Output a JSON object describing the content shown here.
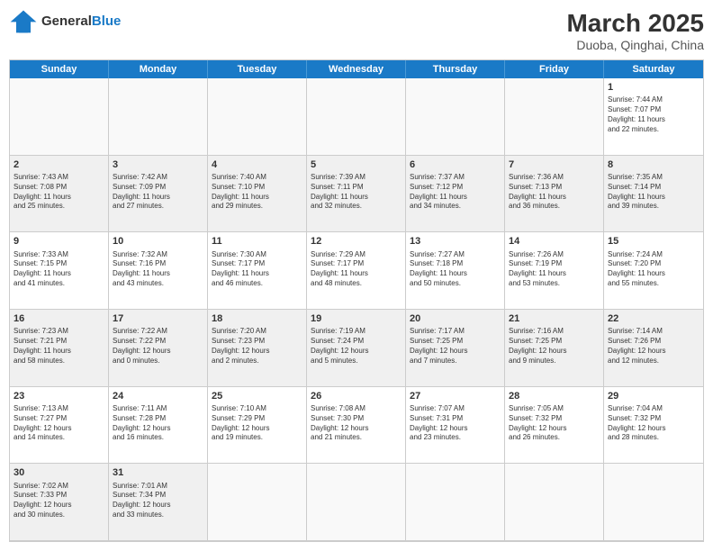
{
  "header": {
    "logo_general": "General",
    "logo_blue": "Blue",
    "month_title": "March 2025",
    "location": "Duoba, Qinghai, China"
  },
  "days_of_week": [
    "Sunday",
    "Monday",
    "Tuesday",
    "Wednesday",
    "Thursday",
    "Friday",
    "Saturday"
  ],
  "cells": [
    {
      "day": "",
      "text": "",
      "empty": true
    },
    {
      "day": "",
      "text": "",
      "empty": true
    },
    {
      "day": "",
      "text": "",
      "empty": true
    },
    {
      "day": "",
      "text": "",
      "empty": true
    },
    {
      "day": "",
      "text": "",
      "empty": true
    },
    {
      "day": "",
      "text": "",
      "empty": true
    },
    {
      "day": "1",
      "text": "Sunrise: 7:44 AM\nSunset: 7:07 PM\nDaylight: 11 hours\nand 22 minutes."
    },
    {
      "day": "2",
      "text": "Sunrise: 7:43 AM\nSunset: 7:08 PM\nDaylight: 11 hours\nand 25 minutes."
    },
    {
      "day": "3",
      "text": "Sunrise: 7:42 AM\nSunset: 7:09 PM\nDaylight: 11 hours\nand 27 minutes."
    },
    {
      "day": "4",
      "text": "Sunrise: 7:40 AM\nSunset: 7:10 PM\nDaylight: 11 hours\nand 29 minutes."
    },
    {
      "day": "5",
      "text": "Sunrise: 7:39 AM\nSunset: 7:11 PM\nDaylight: 11 hours\nand 32 minutes."
    },
    {
      "day": "6",
      "text": "Sunrise: 7:37 AM\nSunset: 7:12 PM\nDaylight: 11 hours\nand 34 minutes."
    },
    {
      "day": "7",
      "text": "Sunrise: 7:36 AM\nSunset: 7:13 PM\nDaylight: 11 hours\nand 36 minutes."
    },
    {
      "day": "8",
      "text": "Sunrise: 7:35 AM\nSunset: 7:14 PM\nDaylight: 11 hours\nand 39 minutes."
    },
    {
      "day": "9",
      "text": "Sunrise: 7:33 AM\nSunset: 7:15 PM\nDaylight: 11 hours\nand 41 minutes."
    },
    {
      "day": "10",
      "text": "Sunrise: 7:32 AM\nSunset: 7:16 PM\nDaylight: 11 hours\nand 43 minutes."
    },
    {
      "day": "11",
      "text": "Sunrise: 7:30 AM\nSunset: 7:17 PM\nDaylight: 11 hours\nand 46 minutes."
    },
    {
      "day": "12",
      "text": "Sunrise: 7:29 AM\nSunset: 7:17 PM\nDaylight: 11 hours\nand 48 minutes."
    },
    {
      "day": "13",
      "text": "Sunrise: 7:27 AM\nSunset: 7:18 PM\nDaylight: 11 hours\nand 50 minutes."
    },
    {
      "day": "14",
      "text": "Sunrise: 7:26 AM\nSunset: 7:19 PM\nDaylight: 11 hours\nand 53 minutes."
    },
    {
      "day": "15",
      "text": "Sunrise: 7:24 AM\nSunset: 7:20 PM\nDaylight: 11 hours\nand 55 minutes."
    },
    {
      "day": "16",
      "text": "Sunrise: 7:23 AM\nSunset: 7:21 PM\nDaylight: 11 hours\nand 58 minutes."
    },
    {
      "day": "17",
      "text": "Sunrise: 7:22 AM\nSunset: 7:22 PM\nDaylight: 12 hours\nand 0 minutes."
    },
    {
      "day": "18",
      "text": "Sunrise: 7:20 AM\nSunset: 7:23 PM\nDaylight: 12 hours\nand 2 minutes."
    },
    {
      "day": "19",
      "text": "Sunrise: 7:19 AM\nSunset: 7:24 PM\nDaylight: 12 hours\nand 5 minutes."
    },
    {
      "day": "20",
      "text": "Sunrise: 7:17 AM\nSunset: 7:25 PM\nDaylight: 12 hours\nand 7 minutes."
    },
    {
      "day": "21",
      "text": "Sunrise: 7:16 AM\nSunset: 7:25 PM\nDaylight: 12 hours\nand 9 minutes."
    },
    {
      "day": "22",
      "text": "Sunrise: 7:14 AM\nSunset: 7:26 PM\nDaylight: 12 hours\nand 12 minutes."
    },
    {
      "day": "23",
      "text": "Sunrise: 7:13 AM\nSunset: 7:27 PM\nDaylight: 12 hours\nand 14 minutes."
    },
    {
      "day": "24",
      "text": "Sunrise: 7:11 AM\nSunset: 7:28 PM\nDaylight: 12 hours\nand 16 minutes."
    },
    {
      "day": "25",
      "text": "Sunrise: 7:10 AM\nSunset: 7:29 PM\nDaylight: 12 hours\nand 19 minutes."
    },
    {
      "day": "26",
      "text": "Sunrise: 7:08 AM\nSunset: 7:30 PM\nDaylight: 12 hours\nand 21 minutes."
    },
    {
      "day": "27",
      "text": "Sunrise: 7:07 AM\nSunset: 7:31 PM\nDaylight: 12 hours\nand 23 minutes."
    },
    {
      "day": "28",
      "text": "Sunrise: 7:05 AM\nSunset: 7:32 PM\nDaylight: 12 hours\nand 26 minutes."
    },
    {
      "day": "29",
      "text": "Sunrise: 7:04 AM\nSunset: 7:32 PM\nDaylight: 12 hours\nand 28 minutes."
    },
    {
      "day": "30",
      "text": "Sunrise: 7:02 AM\nSunset: 7:33 PM\nDaylight: 12 hours\nand 30 minutes."
    },
    {
      "day": "31",
      "text": "Sunrise: 7:01 AM\nSunset: 7:34 PM\nDaylight: 12 hours\nand 33 minutes."
    },
    {
      "day": "",
      "text": "",
      "empty": true
    },
    {
      "day": "",
      "text": "",
      "empty": true
    },
    {
      "day": "",
      "text": "",
      "empty": true
    },
    {
      "day": "",
      "text": "",
      "empty": true
    },
    {
      "day": "",
      "text": "",
      "empty": true
    }
  ]
}
